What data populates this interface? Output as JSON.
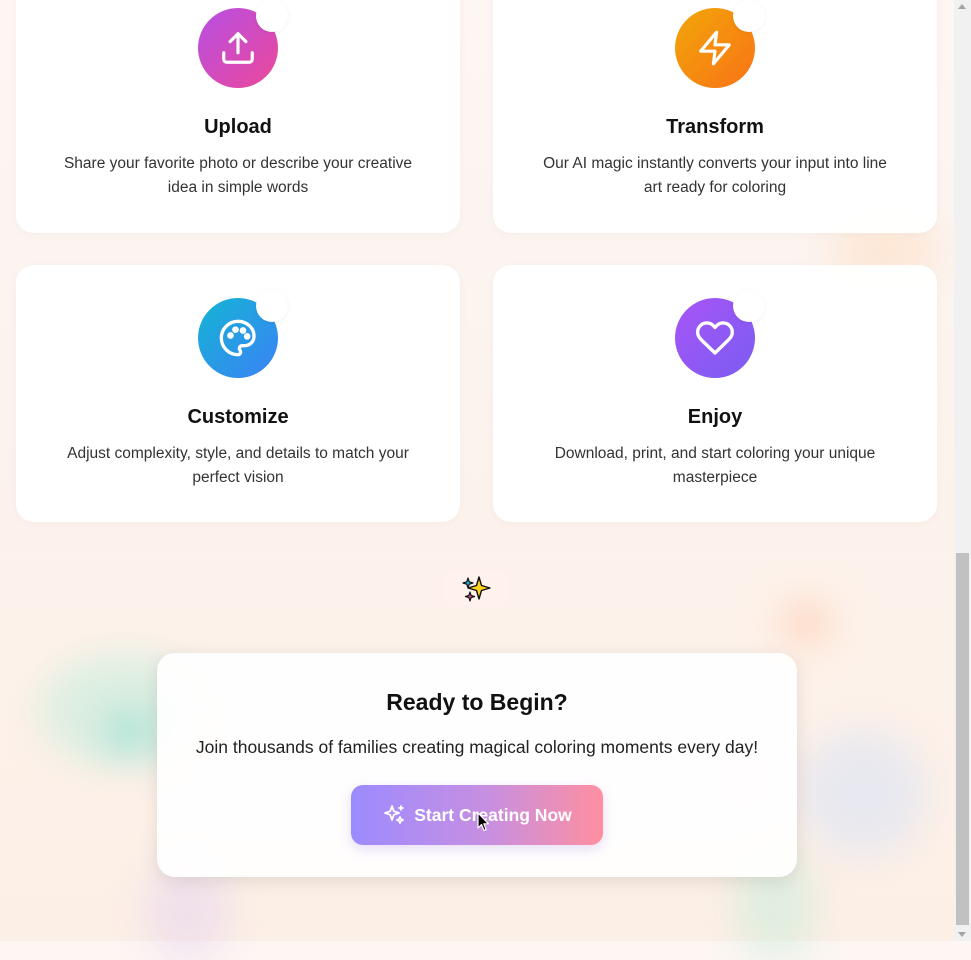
{
  "steps": [
    {
      "title": "Upload",
      "description": "Share your favorite photo or describe your creative idea in simple words",
      "icon": "upload-icon",
      "color_from": "#c04be0",
      "color_to": "#ec4899"
    },
    {
      "title": "Transform",
      "description": "Our AI magic instantly converts your input into line art ready for coloring",
      "icon": "lightning-icon",
      "color_from": "#f5a30b",
      "color_to": "#f97316"
    },
    {
      "title": "Customize",
      "description": "Adjust complexity, style, and details to match your perfect vision",
      "icon": "palette-icon",
      "color_from": "#14b0d6",
      "color_to": "#3b82f6"
    },
    {
      "title": "Enjoy",
      "description": "Download, print, and start coloring your unique masterpiece",
      "icon": "heart-icon",
      "color_from": "#a855f7",
      "color_to": "#7c5cf0"
    }
  ],
  "divider_icon": "sparkles-icon",
  "cta": {
    "title": "Ready to Begin?",
    "subtitle": "Join thousands of families creating magical coloring moments every day!",
    "button_label": "Start Creating Now",
    "button_icon": "sparkles-icon"
  }
}
